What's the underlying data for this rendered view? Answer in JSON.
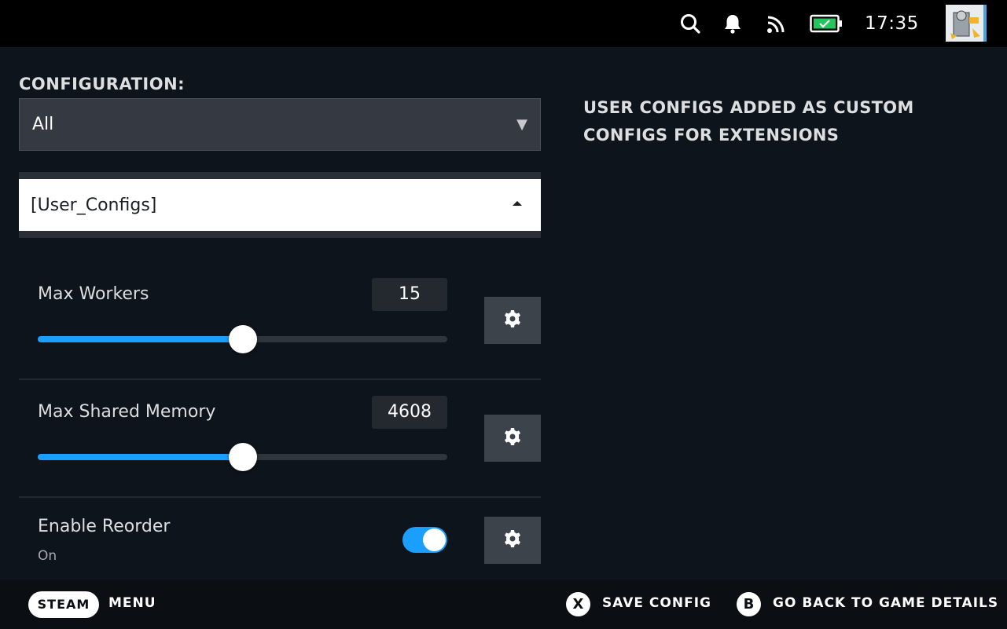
{
  "topbar": {
    "icons": [
      "search-icon",
      "bell-icon",
      "rss-icon",
      "battery-icon"
    ],
    "clock": "17:35",
    "battery_color": "#22c55e"
  },
  "config": {
    "label": "CONFIGURATION:",
    "selected": "All",
    "caret": "▼"
  },
  "section": {
    "selected": "[User_Configs]"
  },
  "settings": [
    {
      "label": "Max Workers",
      "value": "15",
      "fraction": 0.5
    },
    {
      "label": "Max Shared Memory",
      "value": "4608",
      "fraction": 0.5
    },
    {
      "label": "Enable Reorder",
      "state": "On",
      "toggled": true
    }
  ],
  "description": "USER CONFIGS ADDED AS CUSTOM CONFIGS FOR EXTENSIONS",
  "footer": {
    "steam": "STEAM",
    "menu": "MENU",
    "x_button": "X",
    "save": "SAVE CONFIG",
    "b_button": "B",
    "back": "GO BACK TO GAME DETAILS"
  },
  "colors": {
    "accent": "#1a9fff",
    "background": "#0e141b"
  }
}
